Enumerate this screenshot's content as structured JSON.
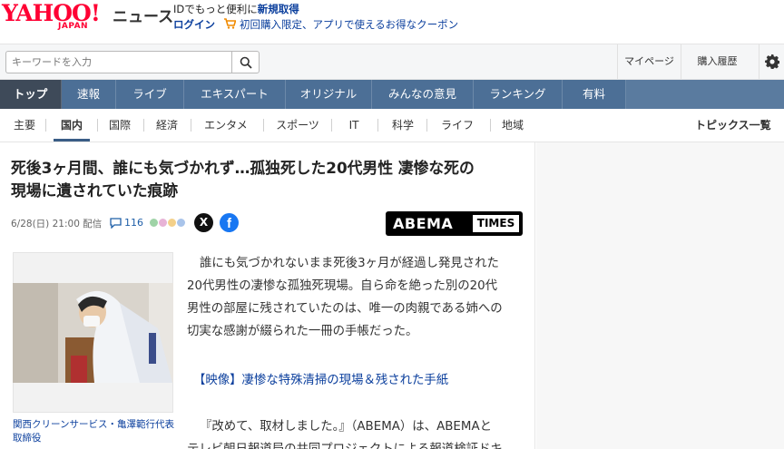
{
  "header": {
    "logo_text": "YAHOO!",
    "logo_sub": "JAPAN",
    "service_name": "ニュース",
    "promo_prefix": "IDでもっと便利に",
    "promo_link": "新規取得",
    "login": "ログイン",
    "coupon_text": "初回購入限定、アプリで使えるお得なクーポン"
  },
  "search": {
    "placeholder": "キーワードを入力",
    "mypage": "マイページ",
    "purchase_history": "購入履歴"
  },
  "main_nav": [
    "トップ",
    "速報",
    "ライブ",
    "エキスパート",
    "オリジナル",
    "みんなの意見",
    "ランキング",
    "有料"
  ],
  "sub_nav": [
    "主要",
    "国内",
    "国際",
    "経済",
    "エンタメ",
    "スポーツ",
    "IT",
    "科学",
    "ライフ",
    "地域"
  ],
  "topics_link": "トピックス一覧",
  "article": {
    "title_line1": "死後3ヶ月間、誰にも気づかれず…孤独死した20代男性 凄惨な死の",
    "title_line2": "現場に遺されていた痕跡",
    "date": "6/28(日) 21:00",
    "delivered": "配信",
    "comment_count": "116",
    "share_x": "X",
    "share_fb": "f",
    "source_logo_main": "ABEMA",
    "source_logo_sub": "TIMES",
    "photo_caption": "関西クリーンサービス・亀澤範行代表取締役",
    "body_lines": [
      "誰にも気づかれないまま死後3ヶ月が経過し発見された",
      "20代男性の凄惨な孤独死現場。自ら命を絶った別の20代",
      "男性の部屋に残されていたのは、唯一の肉親である姉への",
      "切実な感謝が綴られた一冊の手帳だった。"
    ],
    "video_link": "【映像】凄惨な特殊清掃の現場＆残された手紙",
    "body2_lines": [
      "『改めて、取材しました。』（ABEMA）は、ABEMAと",
      "テレビ朝日報道局の共同プロジェクトによる報道検証ドキ"
    ]
  },
  "colors": {
    "brand_red": "#ff0033",
    "nav_blue": "#4c6f96",
    "nav_active": "#3e4a59",
    "link_blue": "#0b3f9d"
  }
}
